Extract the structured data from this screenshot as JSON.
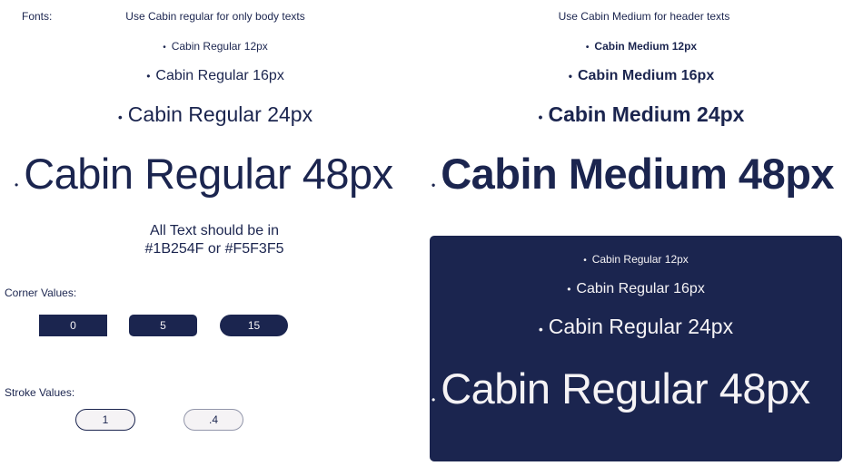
{
  "header": {
    "fonts_label": "Fonts:",
    "left_note": "Use Cabin regular for only body texts",
    "right_note": "Use Cabin Medium for header texts"
  },
  "bullet": "•",
  "regular_samples": [
    "Cabin Regular 12px",
    "Cabin Regular 16px",
    "Cabin Regular 24px",
    "Cabin Regular 48px"
  ],
  "medium_samples": [
    "Cabin Medium 12px",
    "Cabin Medium 16px",
    "Cabin Medium 24px",
    "Cabin Medium 48px"
  ],
  "text_color_note": {
    "line1": "All Text should be in",
    "line2": "#1B254F or #F5F3F5"
  },
  "corner": {
    "label": "Corner Values:",
    "chips": [
      "0",
      "5",
      "15"
    ]
  },
  "stroke": {
    "label": "Stroke Values:",
    "chips": [
      "1",
      ".4"
    ]
  },
  "dark_panel_samples": [
    "Cabin Regular 12px",
    "Cabin Regular 16px",
    "Cabin Regular 24px",
    "Cabin Regular 48px"
  ],
  "colors": {
    "navy": "#1B254F",
    "off_white": "#F5F3F5"
  }
}
